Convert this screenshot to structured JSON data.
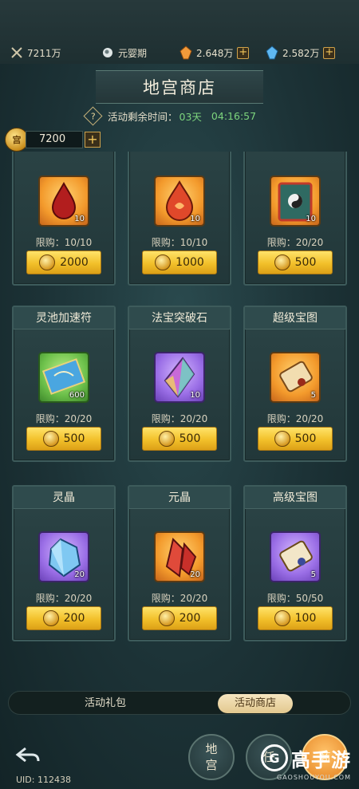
{
  "topbar": {
    "power": "7211万",
    "realm": "元婴期",
    "crystal_orange": "2.648万",
    "crystal_blue": "2.582万"
  },
  "header": {
    "title": "地宫商店",
    "timer_label": "活动剩余时间：",
    "timer_days": "03天",
    "timer_time": "04:16:57",
    "coin_label": "宫",
    "coin_amount": "7200",
    "plus": "+",
    "help": "?"
  },
  "items": [
    {
      "title": "",
      "qty": "10",
      "limit": "限购：10/10",
      "price": "2000",
      "icon": "blood-drop-icon",
      "frame": "orange"
    },
    {
      "title": "",
      "qty": "10",
      "limit": "限购：10/10",
      "price": "1000",
      "icon": "flame-drop-icon",
      "frame": "orange"
    },
    {
      "title": "",
      "qty": "10",
      "limit": "限购：20/20",
      "price": "500",
      "icon": "taiji-book-icon",
      "frame": "orange"
    },
    {
      "title": "灵池加速符",
      "qty": "600",
      "limit": "限购：20/20",
      "price": "500",
      "icon": "talisman-scroll-icon",
      "frame": "green"
    },
    {
      "title": "法宝突破石",
      "qty": "10",
      "limit": "限购：20/20",
      "price": "500",
      "icon": "rainbow-gem-icon",
      "frame": "purple"
    },
    {
      "title": "超级宝图",
      "qty": "5",
      "limit": "限购：20/20",
      "price": "500",
      "icon": "map-scroll-icon",
      "frame": "orange"
    },
    {
      "title": "灵晶",
      "qty": "20",
      "limit": "限购：20/20",
      "price": "200",
      "icon": "blue-crystal-icon",
      "frame": "purple"
    },
    {
      "title": "元晶",
      "qty": "20",
      "limit": "限购：20/20",
      "price": "200",
      "icon": "red-crystal-icon",
      "frame": "orange"
    },
    {
      "title": "高级宝图",
      "qty": "5",
      "limit": "限购：50/50",
      "price": "100",
      "icon": "map-scroll-icon",
      "frame": "purple"
    }
  ],
  "tabs": {
    "gift": "活动礼包",
    "shop": "活动商店"
  },
  "bottom": {
    "uid": "UID: 112438",
    "btn_dungeon_1": "地",
    "btn_dungeon_2": "宫",
    "btn_task": "任",
    "btn_shop": "商"
  },
  "watermark": {
    "logo": "G",
    "text": "高手游",
    "sub": "GAOSHOUYOU.COM"
  },
  "colors": {
    "accent_gold": "#f2c02a",
    "timer_green": "#7dd47d",
    "panel": "#223739"
  }
}
